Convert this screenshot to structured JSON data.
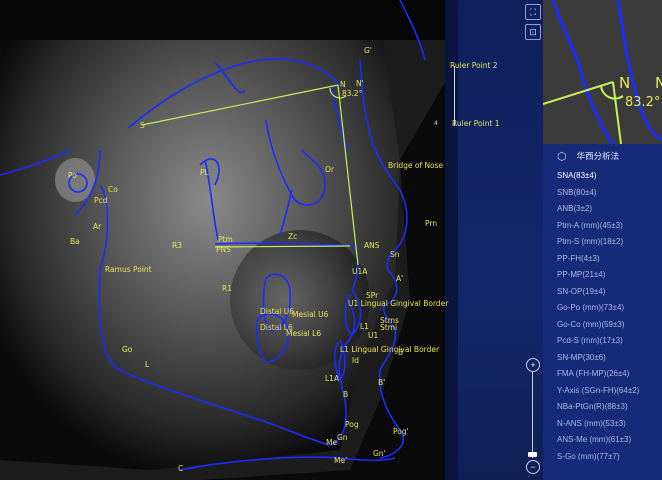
{
  "landmarks": {
    "G_prime": "G'",
    "N": "N",
    "N_prime": "N'",
    "S": "S",
    "Or": "Or",
    "Po": "Po",
    "Pcd": "Pcd",
    "Ar": "Ar",
    "Ba": "Ba",
    "PL": "PL",
    "Ptm": "Ptm",
    "PNS": "PNS",
    "Pt": "Pt",
    "Zc": "Zc",
    "R3": "R3",
    "R1": "R1",
    "ANS": "ANS",
    "Sn": "Sn",
    "Prn": "Prn",
    "A": "A",
    "A_prime": "A'",
    "U1A": "U1A",
    "SPr": "SPr",
    "U1": "U1",
    "L1": "L1",
    "Stms": "Stms",
    "Stmi": "Stmi",
    "Id": "Id",
    "L1A": "L1A",
    "B": "B",
    "B_prime": "B'",
    "Pog": "Pog",
    "Pog_prime": "Pog'",
    "Me": "Me",
    "Gn": "Gn",
    "Me_prime": "Me'",
    "Gn_prime": "Gn'",
    "Go": "Go",
    "C": "C",
    "Distal_U6": "Distal U6",
    "Mesial_U6": "Mesial U6",
    "Distal_L6": "Distal L6",
    "Mesial_L6": "Mesial L6",
    "U1_lingual": "U1 Lingual Gingival Border",
    "L1_lingual": "L1 Lingual Gingival Border",
    "Bridge_of_Nose": "Bridge of Nose",
    "Ramus_Point": "Ramus Point",
    "Ruler_Point_2": "Ruler Point 2",
    "Ruler_Point_1": "Ruler Point 1",
    "ruler_tick": "4"
  },
  "angle_label": "83.2°",
  "mag": {
    "N": "N",
    "angle": "83.2°"
  },
  "analysis": {
    "title": "华西分析法",
    "active_index": 0,
    "items": [
      "SNA(83±4)",
      "SNB(80±4)",
      "ANB(3±2)",
      "Ptm-A (mm)(45±3)",
      "Ptm-S (mm)(18±2)",
      "PP-FH(4±3)",
      "PP-MP(21±4)",
      "SN-OP(19±4)",
      "Go-Po (mm)(73±4)",
      "Go-Co (mm)(59±3)",
      "Pcd-S (mm)(17±3)",
      "SN-MP(30±6)",
      "FMA (FH-MP)(26±4)",
      "Y-Axis (SGn-FH)(64±2)",
      "NBa-PtGn(R)(88±3)",
      "N-ANS (mm)(53±3)",
      "ANS-Me (mm)(61±3)",
      "S-Go (mm)(77±7)"
    ]
  },
  "zoom": {
    "plus": "+",
    "minus": "−",
    "level": 0.05
  },
  "icons": {
    "fullscreen": "fullscreen-icon",
    "fit": "fit-screen-icon",
    "analysis": "hexagon-icon"
  },
  "colors": {
    "tracing": "#1a2cff",
    "line": "#c8f05a",
    "label": "#e8e35a",
    "panel": "#162a7a"
  }
}
